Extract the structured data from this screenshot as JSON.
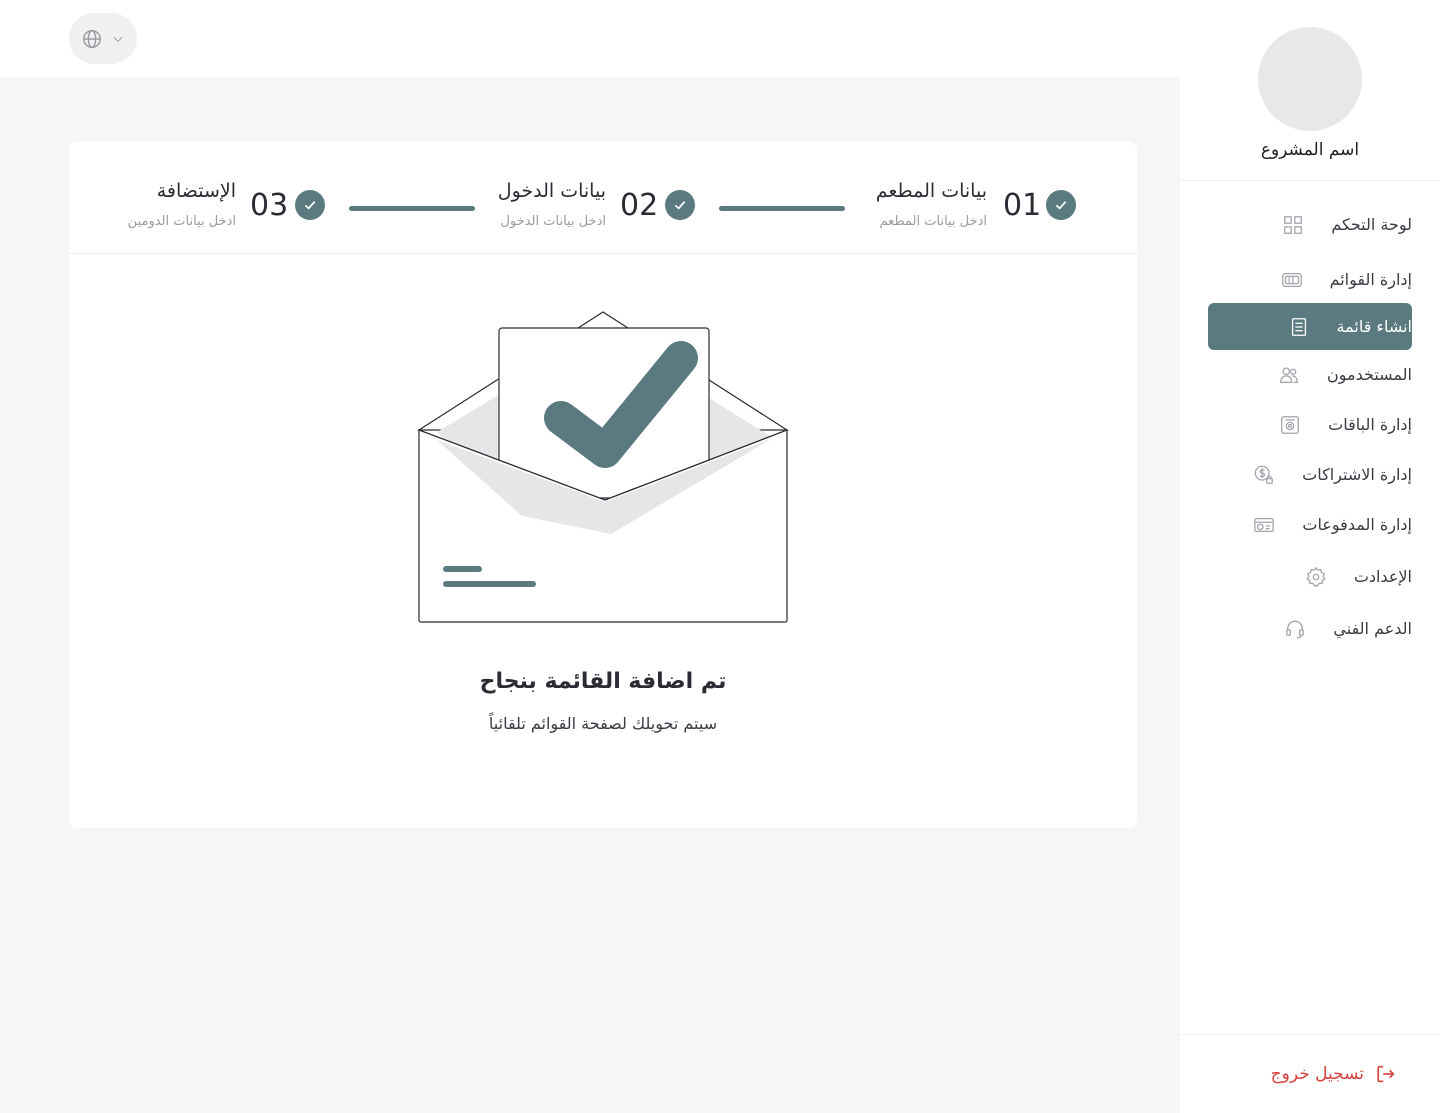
{
  "sidebar": {
    "project_name": "اسم المشروع",
    "items": [
      {
        "label": "لوحة التحكم",
        "icon": "grid-icon"
      },
      {
        "label": "إدارة القوائم",
        "icon": "menu-board-icon"
      },
      {
        "label": "انشاء قائمة",
        "icon": "document-icon",
        "active": true
      },
      {
        "label": "المستخدمون",
        "icon": "users-icon"
      },
      {
        "label": "إدارة الباقات",
        "icon": "package-icon"
      },
      {
        "label": "إدارة الاشتراكات",
        "icon": "subscription-icon"
      },
      {
        "label": "إدارة المدفوعات",
        "icon": "payments-icon"
      },
      {
        "label": "الإعدادت",
        "icon": "gear-icon"
      },
      {
        "label": "الدعم الفني",
        "icon": "headset-icon"
      }
    ],
    "logout_label": "تسجيل خروج"
  },
  "stepper": {
    "steps": [
      {
        "number": "01",
        "title": "بيانات المطعم",
        "subtitle": "ادخل بيانات المطعم"
      },
      {
        "number": "02",
        "title": "بيانات الدخول",
        "subtitle": "ادخل بيانات الدخول"
      },
      {
        "number": "03",
        "title": "الإستضافة",
        "subtitle": "ادخل بيانات الدومين"
      }
    ]
  },
  "success": {
    "title": "تم اضافة القائمة بنجاح",
    "subtitle": "سيتم تحويلك لصفحة القوائم تلقائياً"
  },
  "colors": {
    "accent": "#5b7a80",
    "danger": "#d8433f",
    "background": "#f6f6f7"
  }
}
